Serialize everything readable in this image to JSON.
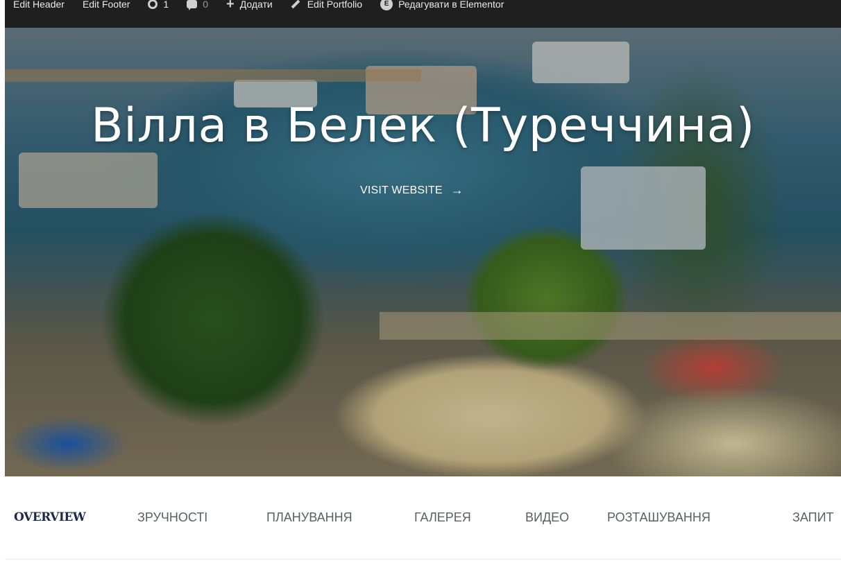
{
  "admin_bar": {
    "edit_header": "Edit Header",
    "edit_footer": "Edit Footer",
    "updates_count": "1",
    "comments_count": "0",
    "add_new": "Додати",
    "edit_portfolio": "Edit Portfolio",
    "edit_elementor": "Редагувати в Elementor",
    "icons": [
      "updates-icon",
      "comments-icon",
      "plus-icon",
      "pencil-icon",
      "elementor-icon"
    ]
  },
  "hero": {
    "title": "Вілла в Белек (Туреччина)",
    "visit_label": "VISIT WEBSITE",
    "visit_arrow": "→"
  },
  "tabs": [
    {
      "label": "OVERVIEW",
      "active": true
    },
    {
      "label": "ЗРУЧНОСТІ",
      "active": false
    },
    {
      "label": "ПЛАНУВАННЯ",
      "active": false
    },
    {
      "label": "ГАЛЕРЕЯ",
      "active": false
    },
    {
      "label": "ВИДЕО",
      "active": false
    },
    {
      "label": "РОЗТАШУВАННЯ",
      "active": false
    },
    {
      "label": "ЗАПИТ",
      "active": false
    }
  ],
  "colors": {
    "admin_bar_bg": "#1f1f1f",
    "active_tab": "#1b2a4a",
    "inactive_tab": "#5a5f66"
  }
}
